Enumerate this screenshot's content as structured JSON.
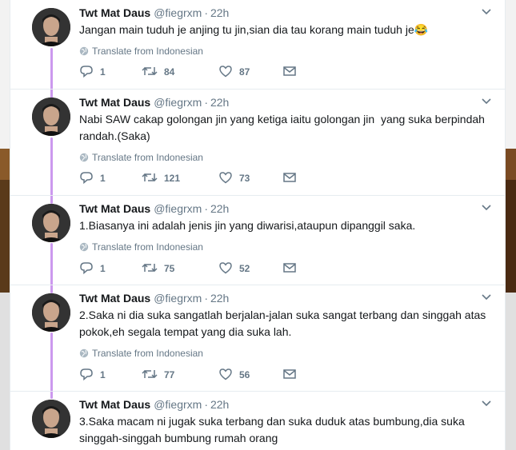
{
  "tweets": [
    {
      "name": "Twt Mat Daus",
      "handle": "@fiegrxm",
      "time": "22h",
      "text": "Jangan main tuduh je anjing tu jin,sian dia tau korang main tuduh je😂",
      "translate": "Translate from Indonesian",
      "replies": "1",
      "retweets": "84",
      "likes": "87"
    },
    {
      "name": "Twt Mat Daus",
      "handle": "@fiegrxm",
      "time": "22h",
      "text": "Nabi SAW cakap golongan jin yang ketiga iaitu golongan jin  yang suka berpindah randah.(Saka)",
      "translate": "Translate from Indonesian",
      "replies": "1",
      "retweets": "121",
      "likes": "73"
    },
    {
      "name": "Twt Mat Daus",
      "handle": "@fiegrxm",
      "time": "22h",
      "text": "1.Biasanya ini adalah jenis jin yang diwarisi,ataupun dipanggil saka.",
      "translate": "Translate from Indonesian",
      "replies": "1",
      "retweets": "75",
      "likes": "52"
    },
    {
      "name": "Twt Mat Daus",
      "handle": "@fiegrxm",
      "time": "22h",
      "text": "2.Saka ni dia suka sangatlah berjalan-jalan suka sangat terbang dan singgah atas pokok,eh segala tempat yang dia suka lah.",
      "translate": "Translate from Indonesian",
      "replies": "1",
      "retweets": "77",
      "likes": "56"
    },
    {
      "name": "Twt Mat Daus",
      "handle": "@fiegrxm",
      "time": "22h",
      "text": "3.Saka macam ni jugak suka terbang dan suka duduk atas bumbung,dia suka singgah-singgah bumbung rumah orang"
    }
  ],
  "colors": {
    "thread_line": "#cc99ee",
    "text": "#14171a",
    "secondary": "#657786"
  }
}
